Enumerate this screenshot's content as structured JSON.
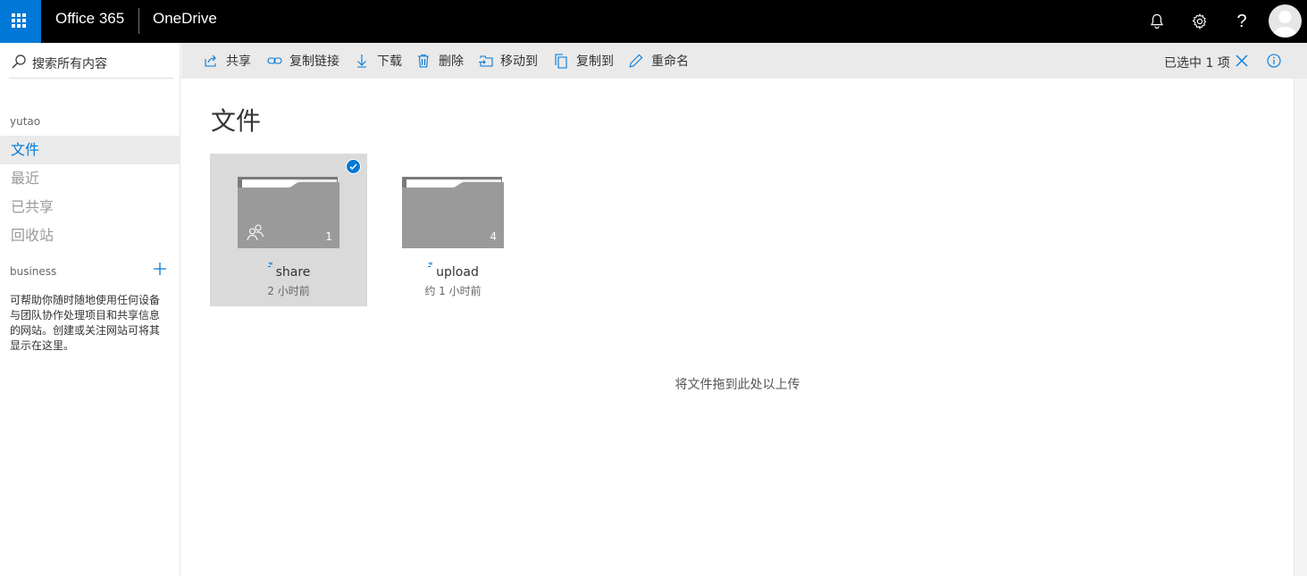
{
  "header": {
    "brand": "Office 365",
    "app_name": "OneDrive",
    "icons": [
      "app-launcher-icon",
      "bell-icon",
      "gear-icon",
      "help-icon",
      "avatar"
    ],
    "accent": "#0078d7"
  },
  "sidebar": {
    "search_placeholder": "搜索所有内容",
    "user": "yutao",
    "items": [
      {
        "label": "文件",
        "active": true
      },
      {
        "label": "最近",
        "active": false
      },
      {
        "label": "已共享",
        "active": false
      },
      {
        "label": "回收站",
        "active": false
      }
    ],
    "sites_heading": "business",
    "sites_description": "可帮助你随时随地使用任何设备与团队协作处理项目和共享信息的网站。创建或关注网站可将其显示在这里。"
  },
  "commandbar": {
    "share": "共享",
    "copy_link": "复制链接",
    "download": "下载",
    "delete": "删除",
    "move_to": "移动到",
    "copy_to": "复制到",
    "rename": "重命名",
    "selection": "已选中 1 项"
  },
  "main": {
    "title": "文件",
    "folders": [
      {
        "name": "share",
        "modified": "2 小时前",
        "count": "1",
        "shared": true,
        "selected": true
      },
      {
        "name": "upload",
        "modified": "约 1 小时前",
        "count": "4",
        "shared": false,
        "selected": false
      }
    ],
    "drop_hint": "将文件拖到此处以上传"
  }
}
